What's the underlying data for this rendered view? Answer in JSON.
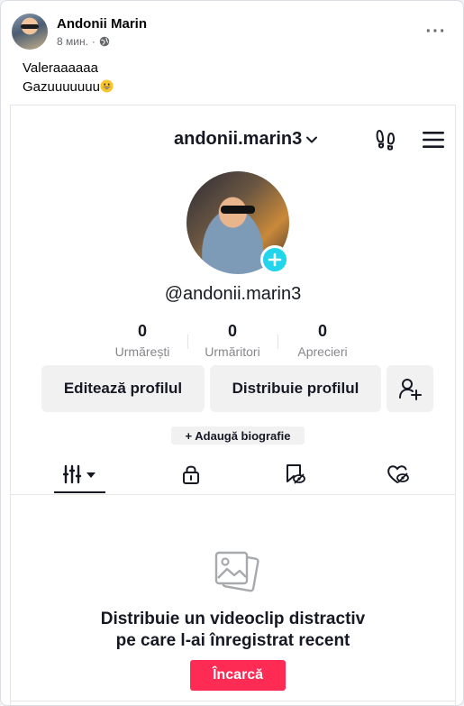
{
  "post": {
    "author_name": "Andonii Marin",
    "time": "8 мин.",
    "separator": "·",
    "audience_icon": "globe-icon",
    "more_icon": "more-horizontal-icon",
    "more_label": "···",
    "text_line1": "Valeraaaaaa",
    "text_line2": "Gazuuuuuuu",
    "emoji_icon": "grinning-face-emoji"
  },
  "tiktok": {
    "username": "andonii.marin3",
    "handle": "@andonii.marin3",
    "stats": [
      {
        "value": "0",
        "label": "Urmărești"
      },
      {
        "value": "0",
        "label": "Urmăritori"
      },
      {
        "value": "0",
        "label": "Aprecieri"
      }
    ],
    "edit_profile_label": "Editează profilul",
    "share_profile_label": "Distribuie profilul",
    "add_bio_label": "+ Adaugă biografie",
    "empty_title_line1": "Distribuie un videoclip distractiv",
    "empty_title_line2": "pe care l-ai înregistrat recent",
    "upload_label": "Încarcă",
    "accent_color": "#fe2c55",
    "badge_color": "#20d5ec"
  }
}
